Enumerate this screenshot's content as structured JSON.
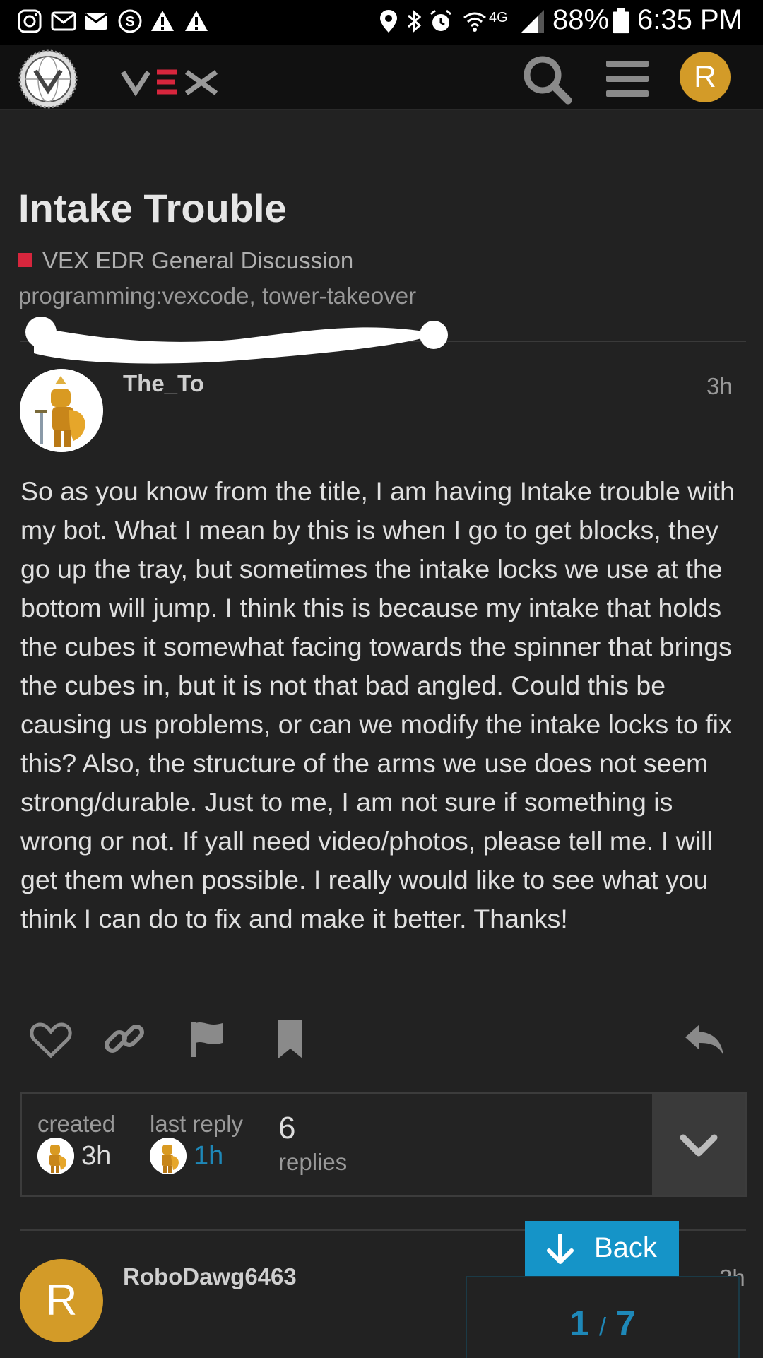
{
  "status_bar": {
    "battery": "88%",
    "time": "6:35 PM",
    "network": "4G",
    "icons": [
      "instagram-icon",
      "gmail-icon",
      "mail-icon",
      "app-s-icon",
      "warning-icon",
      "warning-icon",
      "location-icon",
      "bluetooth-icon",
      "alarm-icon",
      "wifi-icon",
      "signal-icon",
      "battery-icon"
    ]
  },
  "header": {
    "logo": "site-logo",
    "brand": "VEX",
    "user_initial": "R",
    "user_color": "#d39b28"
  },
  "topic": {
    "title": "Intake Trouble",
    "category": "VEX EDR General Discussion",
    "category_color": "#d7263d",
    "tags": "programming:vexcode, tower-takeover"
  },
  "post": {
    "author": "The_To",
    "age": "3h",
    "body": "So as you know from the title, I am having Intake trouble with my bot. What I mean by this is when I go to get blocks, they go up the tray, but sometimes the intake locks we use at the bottom will jump. I think this is because my intake that holds the cubes it somewhat facing towards the spinner that brings the cubes in, but it is not that bad angled. Could this be causing us problems, or can we modify the intake locks to fix this? Also, the structure of the arms we use does not seem strong/durable. Just to me, I am not sure if something is wrong or not. If yall need video/photos, please tell me. I will get them when possible. I really would like to see what you think I can do to fix and make it better. Thanks!"
  },
  "topic_map": {
    "created_label": "created",
    "created_value": "3h",
    "last_reply_label": "last reply",
    "last_reply_value": "1h",
    "replies_count": "6",
    "replies_label": "replies"
  },
  "reply_post": {
    "author": "RoboDawg6463",
    "avatar_initial": "R",
    "age": "2h"
  },
  "controls": {
    "back_label": "Back",
    "progress_current": "1",
    "progress_separator": "/",
    "progress_total": "7"
  },
  "colors": {
    "accent": "#1594c8",
    "background": "#222222"
  }
}
